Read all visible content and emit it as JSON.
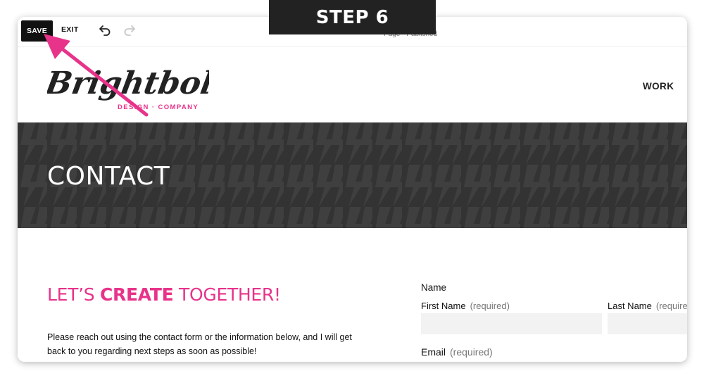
{
  "overlay": {
    "step_label": "STEP 6",
    "arrow_color": "#e8338a"
  },
  "editor_bar": {
    "save_label": "SAVE",
    "exit_label": "EXIT",
    "undo_icon": "undo-icon",
    "redo_icon": "redo-icon",
    "status": "Page · Published"
  },
  "site_header": {
    "logo_text": "Brightbolt",
    "logo_tagline": "DESIGN · COMPANY",
    "nav": [
      {
        "label": "WORK"
      }
    ]
  },
  "banner": {
    "title": "CONTACT",
    "bg_color": "#333333"
  },
  "content": {
    "headline_part1": "LET’S ",
    "headline_bold": "CREATE",
    "headline_part2": " TOGETHER!",
    "intro": "Please reach out using the contact form or the information below, and I will get back to you regarding next steps as soon as possible!",
    "accent_color": "#e8338a"
  },
  "form": {
    "name_label": "Name",
    "first_name_label": "First Name",
    "last_name_label": "Last Name",
    "required_text": "(required)",
    "email_label": "Email",
    "first_name_value": "",
    "last_name_value": ""
  }
}
